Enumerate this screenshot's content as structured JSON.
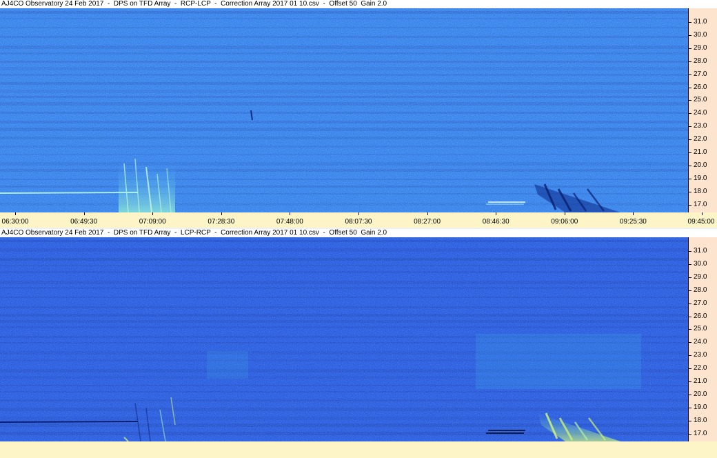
{
  "panels": [
    {
      "title": "AJ4CO Observatory 24 Feb 2017  -  DPS on TFD Array  -  RCP-LCP  -  Correction Array 2017 01 10.csv  -  Offset 50  Gain 2.0",
      "base_color": "#1e6fe6",
      "band_color": "#1553c8"
    },
    {
      "title": "AJ4CO Observatory 24 Feb 2017  -  DPS on TFD Array  -  LCP-RCP  -  Correction Array 2017 01 10.csv  -  Offset 50  Gain 2.0",
      "base_color": "#1849d8",
      "band_color": "#1238b8"
    }
  ],
  "freq_labels": [
    "31.0",
    "30.0",
    "29.0",
    "28.0",
    "27.0",
    "26.0",
    "25.0",
    "24.0",
    "23.0",
    "22.0",
    "21.0",
    "20.0",
    "19.0",
    "18.0",
    "17.0"
  ],
  "time_labels": [
    "06:30:00",
    "06:49:30",
    "07:09:00",
    "07:28:30",
    "07:48:00",
    "08:07:30",
    "08:27:00",
    "08:46:30",
    "09:06:00",
    "09:25:30",
    "09:45:00"
  ],
  "colors": {
    "freq_axis_bg": "#fde4cf",
    "time_axis_bg": "#fdf5c7",
    "burst_light": "#9ef0c8",
    "burst_dark": "#0a1f6e"
  }
}
